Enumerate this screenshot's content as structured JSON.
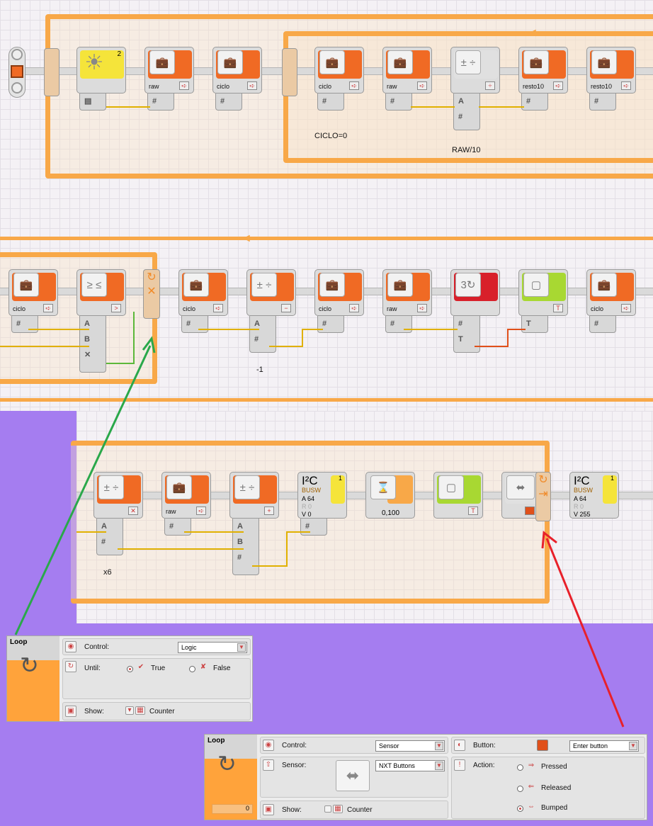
{
  "row1": {
    "blocks": [
      "raw",
      "ciclo",
      "ciclo",
      "raw",
      "resto10",
      "resto10"
    ],
    "light_port": "2",
    "notes": [
      "CICLO=0",
      "RAW/10"
    ]
  },
  "row2": {
    "blocks": [
      "ciclo",
      "ciclo",
      "ciclo",
      "raw",
      "ciclo"
    ],
    "math_ports": [
      "A",
      "B"
    ],
    "notes": [
      "-1"
    ]
  },
  "row3": {
    "blocks": [
      "raw"
    ],
    "i2c": [
      {
        "title": "I²C",
        "sub": "BUSW",
        "port": "1",
        "addr": "A 64",
        "reg": "R 0",
        "val": "V 0"
      },
      {
        "title": "I²C",
        "sub": "BUSW",
        "port": "1",
        "addr": "A 64",
        "reg": "R 0",
        "val": "V 255"
      }
    ],
    "wait_value": "0,100",
    "notes": [
      "x6"
    ]
  },
  "panel_logic": {
    "title": "Loop",
    "control_label": "Control:",
    "control_value": "Logic",
    "until_label": "Until:",
    "true_label": "True",
    "false_label": "False",
    "show_label": "Show:",
    "counter_label": "Counter"
  },
  "panel_sensor": {
    "title": "Loop",
    "control_label": "Control:",
    "control_value": "Sensor",
    "sensor_label": "Sensor:",
    "sensor_value": "NXT Buttons",
    "show_label": "Show:",
    "counter_label": "Counter",
    "counter_value": "0",
    "button_label": "Button:",
    "button_value": "Enter button",
    "action_label": "Action:",
    "actions": [
      "Pressed",
      "Released",
      "Bumped"
    ]
  },
  "colors": {
    "loop": "#f8a848",
    "block_orange": "#f06a24",
    "green_arrow": "#2aa84a",
    "red_arrow": "#e8202a"
  }
}
